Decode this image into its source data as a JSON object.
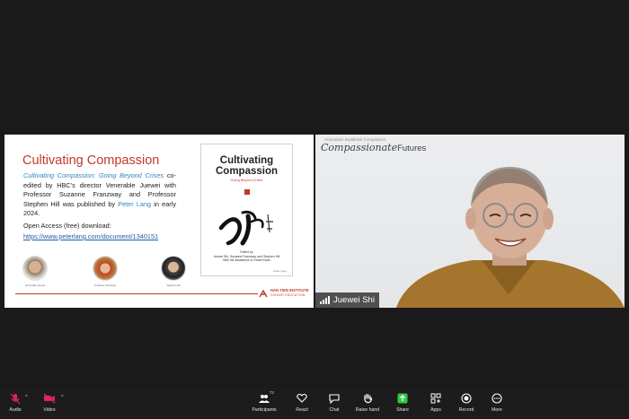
{
  "slide": {
    "title": "Cultivating Compassion",
    "body_em": "Cultivating Compassion: Going Beyond Crises",
    "body_mid": " co-edited by HBC's director Venerable Juewei with Professor Suzanne Franzway and Professor Stephen Hill was published by ",
    "body_link": "Peter Lang",
    "body_end": " in early 2024.",
    "open_access": "Open Access (free) download:",
    "link": "https://www.peterlang.com/document/1340151",
    "people": [
      {
        "caption": "Venerable Juewei"
      },
      {
        "caption": "Suzanne Franzway"
      },
      {
        "caption": "Stephen Hill"
      }
    ],
    "book": {
      "title_line1": "Cultivating",
      "title_line2": "Compassion",
      "subtitle": "Going Beyond Crises",
      "edited_by": "Edited by",
      "editors": "Juewei Shi, Suzanne Franzway, and Stephen Hill",
      "assistance": "With the assistance of Grace Kwan",
      "publisher": "Peter Lang"
    },
    "institute_line1": "NAN TIEN INSTITUTE",
    "institute_line2": "HIGHER EDUCATION",
    "accent_color": "#c0392b"
  },
  "video": {
    "background_subtitle": "Humanistic Buddhism Compassion",
    "background_brand_a": "Compassionate",
    "background_brand_b": "Futures",
    "participant_name": "Juewei Shi"
  },
  "toolbar": {
    "audio": "Audio",
    "video": "Video",
    "participants": "Participants",
    "participants_count": "73",
    "react": "React",
    "chat": "Chat",
    "raise_hand": "Raise hand",
    "share": "Share",
    "apps": "Apps",
    "record": "Record",
    "more": "More",
    "muted_color": "#e0245e",
    "share_color": "#2ecc40"
  }
}
